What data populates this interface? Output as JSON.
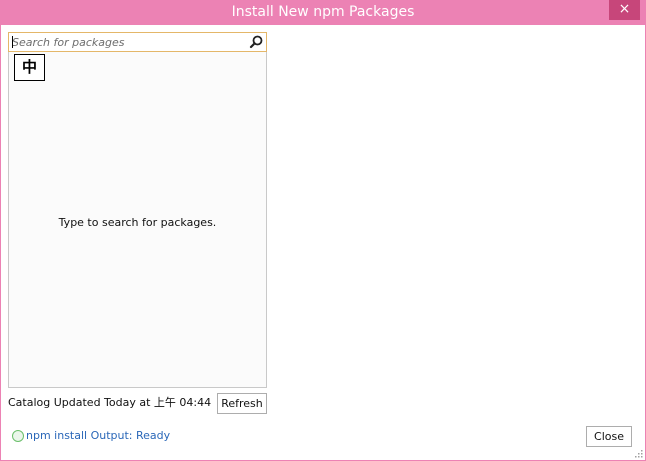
{
  "window": {
    "title": "Install New npm Packages",
    "close_glyph": "×"
  },
  "search": {
    "placeholder": "Search for packages",
    "value": "",
    "icon": "search-icon"
  },
  "ime_indicator": "中",
  "results": {
    "empty_message": "Type to search for packages."
  },
  "catalog": {
    "status_text": "Catalog Updated Today at 上午 04:44",
    "refresh_label": "Refresh"
  },
  "output": {
    "status_text": "npm install Output: Ready"
  },
  "footer": {
    "close_label": "Close"
  },
  "colors": {
    "frame": "#ec82b4",
    "close_button": "#c7467a",
    "search_border": "#e4b769",
    "link": "#2a67b8",
    "status_ok": "#6bbf6b"
  }
}
